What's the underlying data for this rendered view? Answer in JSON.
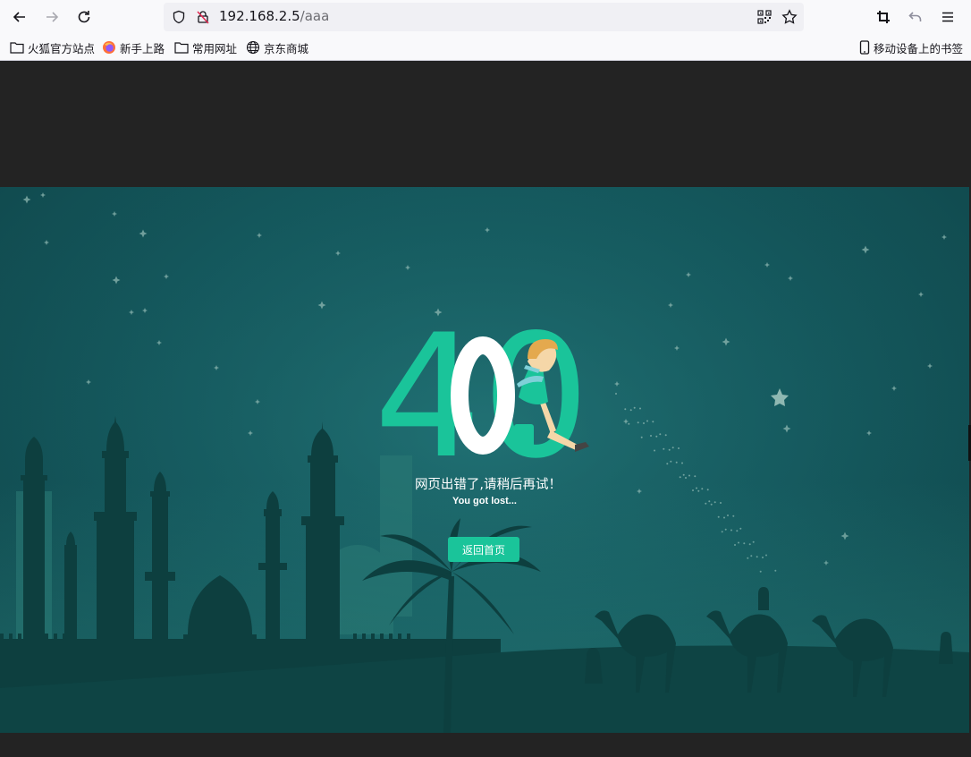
{
  "browser": {
    "url_host": "192.168.2.5",
    "url_path": "/aaa",
    "bookmarks": [
      {
        "label": "火狐官方站点",
        "icon": "folder-icon"
      },
      {
        "label": "新手上路",
        "icon": "firefox-icon"
      },
      {
        "label": "常用网址",
        "icon": "folder-icon"
      },
      {
        "label": "京东商城",
        "icon": "globe-icon"
      }
    ],
    "mobile_bookmarks": "移动设备上的书签"
  },
  "page": {
    "error_digits": "40",
    "message_cn": "网页出错了,请稍后再试！",
    "message_en": "You got lost...",
    "home_button": "返回首页"
  },
  "colors": {
    "accent": "#1ac49a",
    "sky": "#155b60",
    "silhouette": "#0d3f3f"
  }
}
